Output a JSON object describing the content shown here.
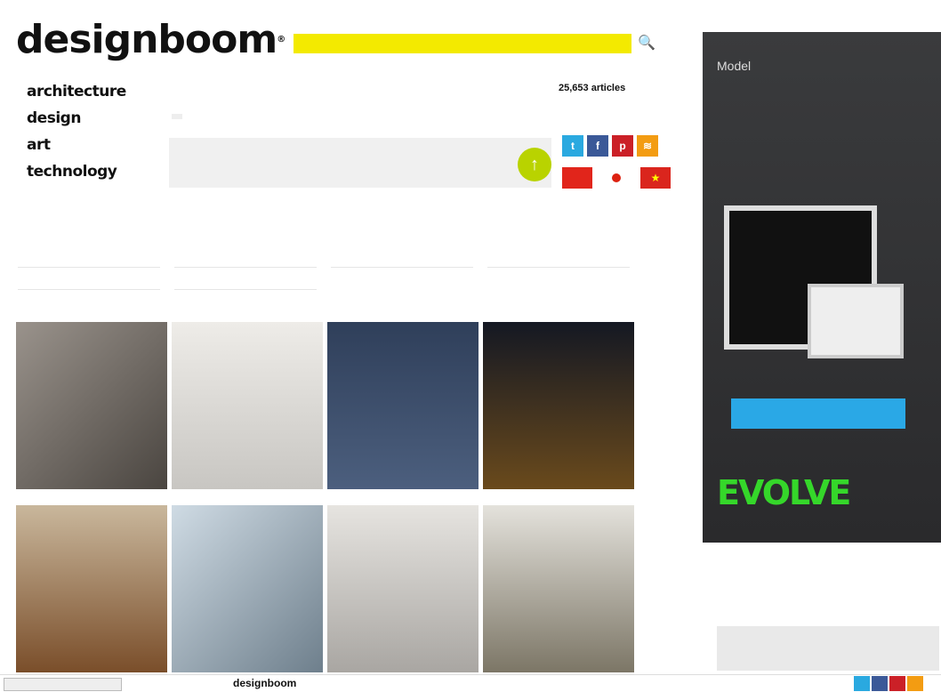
{
  "header": {
    "tagline": "",
    "logo": "designboom",
    "search_placeholder": "",
    "article_count": "25,653 articles"
  },
  "categories": [
    "architecture",
    "design",
    "art",
    "technology"
  ],
  "subnav": {
    "row1": [
      "",
      "",
      "",
      "",
      "",
      ""
    ],
    "row2_active": "",
    "row2": [
      "",
      "",
      "",
      "",
      ""
    ]
  },
  "promo": {
    "line1": "",
    "line2": "",
    "line3": ""
  },
  "colors": {
    "search_yellow": "#f3ea00",
    "twitter": "#2aa9e0",
    "facebook": "#3b5998",
    "pinterest": "#cb2027",
    "rss": "#f39c12",
    "evolve_green": "#35d72a",
    "ad_button": "#2aa8e6"
  },
  "filters": {
    "row1": [
      "",
      "",
      "",
      ""
    ],
    "row2": [
      "",
      ""
    ]
  },
  "products": [
    {
      "label": "",
      "color": "#6b6661"
    },
    {
      "label": "",
      "color": "#d8d6d2"
    },
    {
      "label": "",
      "color": "#3d4f6b"
    },
    {
      "label": "",
      "color": "#2b2418"
    },
    {
      "label": "",
      "color": "#7a4e2a"
    },
    {
      "label": "",
      "color": "#a8b8c6"
    },
    {
      "label": "",
      "color": "#c9c6c2"
    },
    {
      "label": "",
      "color": "#9a9482"
    }
  ],
  "ad": {
    "title_a": "Model",
    "title_b": "",
    "button": "",
    "logo": "EVOLVE"
  },
  "product_library": {
    "title": ""
  },
  "footer": {
    "status": "",
    "logo": "designboom",
    "links": [
      "",
      "",
      "",
      "",
      "",
      "",
      ""
    ]
  }
}
